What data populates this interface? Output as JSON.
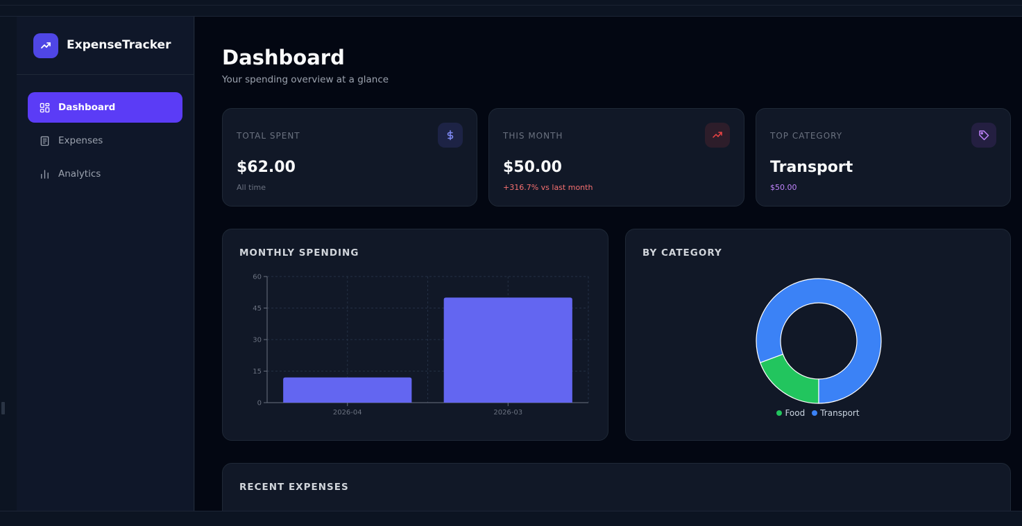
{
  "app": {
    "name": "ExpenseTracker"
  },
  "sidebar": {
    "items": [
      {
        "label": "Dashboard",
        "icon": "layout-grid-icon",
        "active": true
      },
      {
        "label": "Expenses",
        "icon": "receipt-icon",
        "active": false
      },
      {
        "label": "Analytics",
        "icon": "bar-chart-icon",
        "active": false
      }
    ]
  },
  "page": {
    "title": "Dashboard",
    "subtitle": "Your spending overview at a glance"
  },
  "stats": [
    {
      "label": "TOTAL SPENT",
      "value": "$62.00",
      "sub": "All time",
      "icon": "dollar-icon",
      "accent": "#6366f1",
      "sub_color": "#6b7280"
    },
    {
      "label": "THIS MONTH",
      "value": "$50.00",
      "sub": "+316.7% vs last month",
      "icon": "trending-up-icon",
      "accent": "#ef4444",
      "sub_color": "#f87171"
    },
    {
      "label": "TOP CATEGORY",
      "value": "Transport",
      "sub": "$50.00",
      "icon": "tag-icon",
      "accent": "#a855f7",
      "sub_color": "#c084fc"
    }
  ],
  "monthly": {
    "title": "MONTHLY SPENDING"
  },
  "by_category": {
    "title": "BY CATEGORY"
  },
  "recent": {
    "title": "RECENT EXPENSES"
  },
  "chart_data": [
    {
      "type": "bar",
      "title": "MONTHLY SPENDING",
      "categories": [
        "2026-04",
        "2026-03"
      ],
      "values": [
        12,
        50
      ],
      "ylim": [
        0,
        60
      ],
      "yticks": [
        0,
        15,
        30,
        45,
        60
      ],
      "grid": true,
      "color": "#6366f1"
    },
    {
      "type": "pie",
      "title": "BY CATEGORY",
      "labels": [
        "Food",
        "Transport"
      ],
      "values": [
        12,
        50
      ],
      "colors": [
        "#22c55e",
        "#3b82f6"
      ],
      "legend": "bottom"
    }
  ]
}
